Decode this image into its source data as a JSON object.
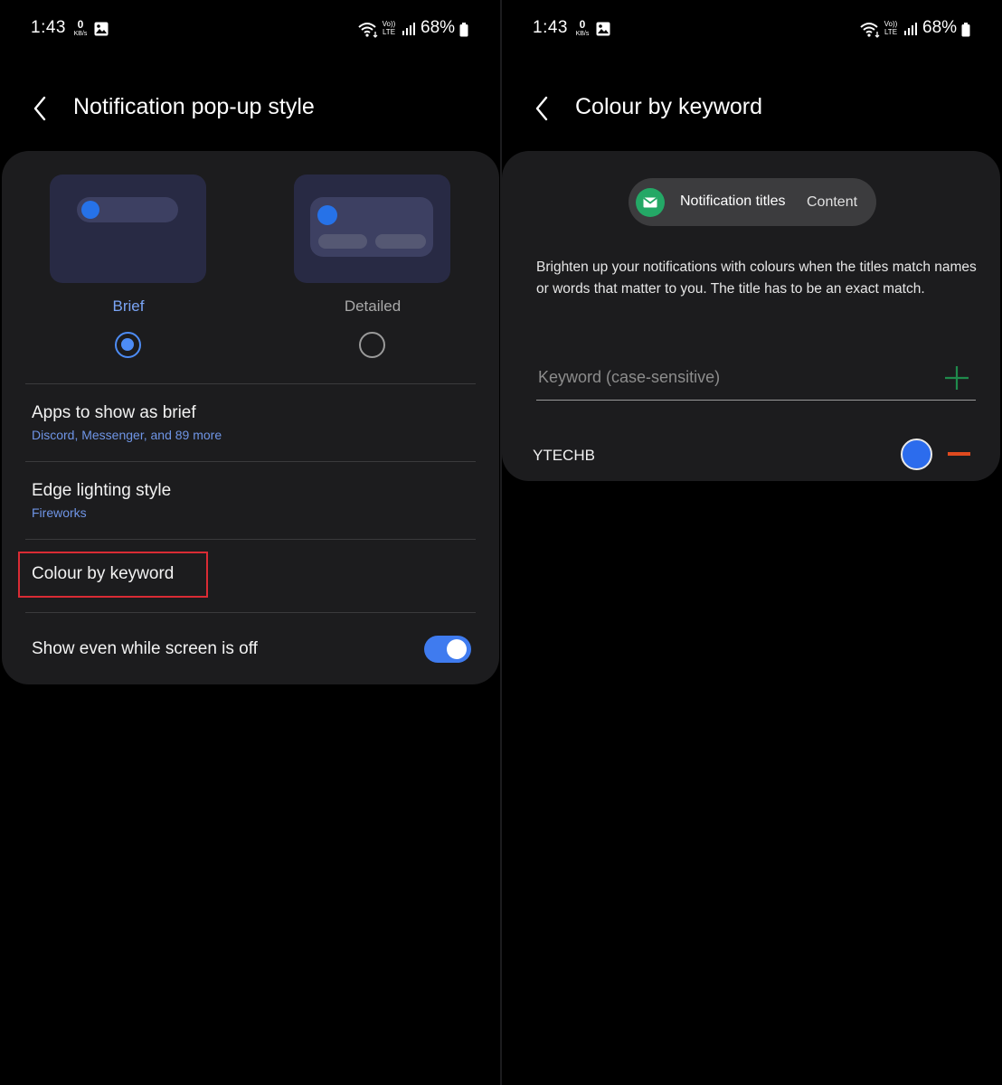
{
  "status_bar": {
    "time": "1:43",
    "kbs_value": "0",
    "kbs_unit": "KB/s",
    "volte_top": "Vo))",
    "volte_bottom": "LTE",
    "battery": "68%"
  },
  "left_screen": {
    "title": "Notification pop-up style",
    "options": [
      {
        "label": "Brief",
        "selected": true
      },
      {
        "label": "Detailed",
        "selected": false
      }
    ],
    "rows": [
      {
        "title": "Apps to show as brief",
        "subtitle": "Discord, Messenger, and 89 more"
      },
      {
        "title": "Edge lighting style",
        "subtitle": "Fireworks"
      },
      {
        "title": "Colour by keyword"
      },
      {
        "title": "Show even while screen is off",
        "toggle_on": true
      }
    ]
  },
  "right_screen": {
    "title": "Colour by keyword",
    "demo_title": "Notification titles",
    "demo_content": "Content",
    "description": "Brighten up your notifications with colours when the titles match names or words that matter to you. The title has to be an exact match.",
    "keyword_placeholder": "Keyword (case-sensitive)",
    "keywords": [
      {
        "text": "YTECHB",
        "color": "#2c6ced"
      }
    ]
  },
  "colors": {
    "accent": "#3f7bef",
    "highlight": "#d92b34",
    "remove": "#e04a1f",
    "add": "#1f8a4c",
    "email_icon": "#24a866"
  }
}
